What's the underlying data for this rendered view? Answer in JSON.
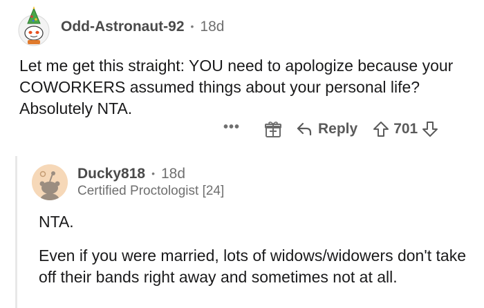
{
  "parent_comment": {
    "username": "Odd-Astronaut-92",
    "separator": "•",
    "age": "18d",
    "body": "Let me get this straight: YOU need to apologize because your COWORKERS assumed things about your personal life? Absolutely NTA.",
    "actions": {
      "more_label": "•••",
      "reply_label": "Reply",
      "vote_count": "701"
    }
  },
  "reply_comment": {
    "username": "Ducky818",
    "separator": "•",
    "age": "18d",
    "flair": "Certified Proctologist [24]",
    "paragraphs": [
      "NTA.",
      "Even if you were married, lots of widows/widowers don't take off their bands right away and sometimes not at all."
    ]
  },
  "icons": {
    "avatar_1": "snoo-avatar-with-tree-hat",
    "avatar_2": "snoo-avatar-peach",
    "gift": "gift-icon",
    "reply": "reply-arrow-icon",
    "upvote": "upvote-arrow-icon",
    "downvote": "downvote-arrow-icon"
  }
}
